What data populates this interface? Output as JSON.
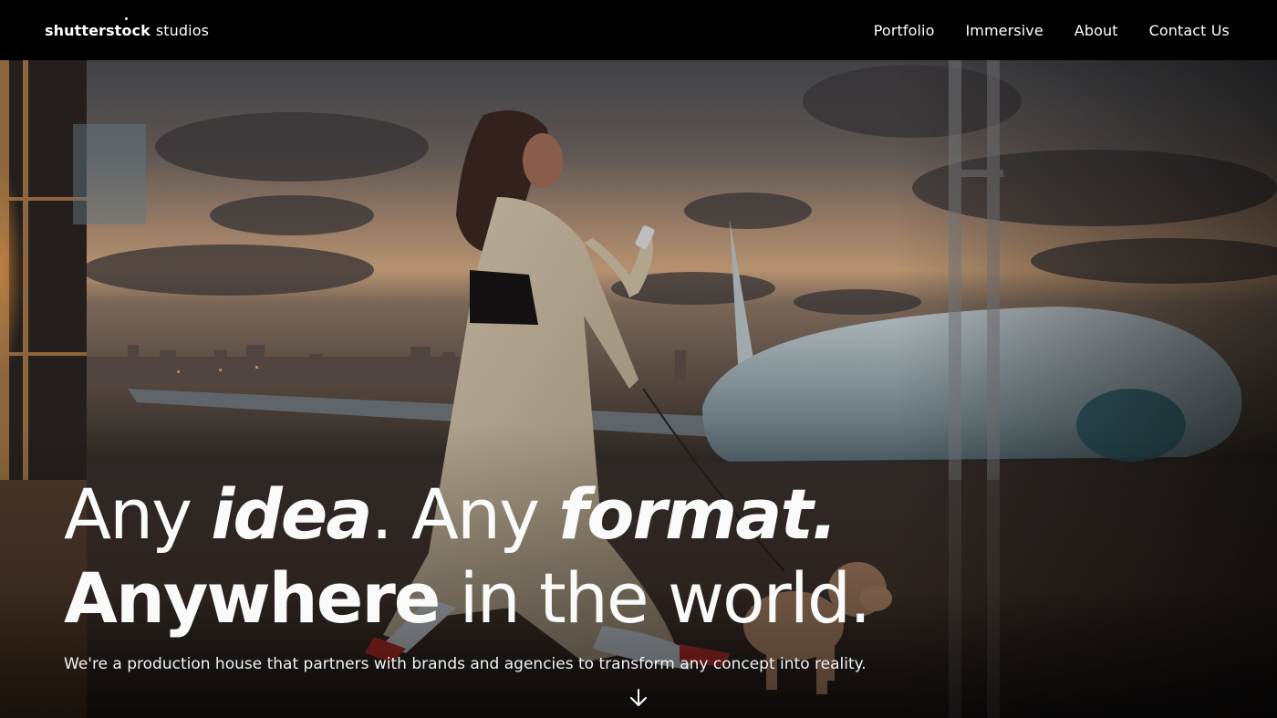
{
  "header": {
    "logo": {
      "brand": "shutterst",
      "o": "o",
      "brand_end": "ck",
      "suffix": "studios"
    },
    "nav": [
      {
        "label": "Portfolio"
      },
      {
        "label": "Immersive"
      },
      {
        "label": "About"
      },
      {
        "label": "Contact Us"
      }
    ]
  },
  "hero": {
    "headline": {
      "line1": {
        "p1": "Any ",
        "p2": "idea",
        "p3": ". Any ",
        "p4": "format."
      },
      "line2": {
        "p1": "Anywhere",
        "p2": " in the world."
      }
    },
    "subtext": "We're a production house that partners with brands and agencies to transform any concept into reality.",
    "scroll_icon": "arrow-down-icon"
  },
  "colors": {
    "header_bg": "#000000",
    "text": "#ffffff"
  }
}
